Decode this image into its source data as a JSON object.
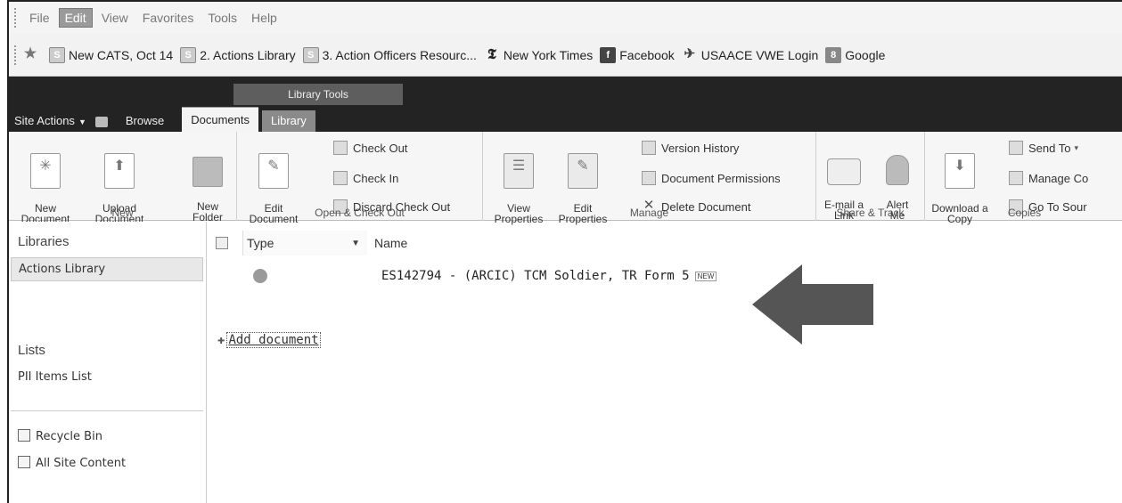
{
  "menu": {
    "items": [
      "File",
      "Edit",
      "View",
      "Favorites",
      "Tools",
      "Help"
    ],
    "active": "Edit"
  },
  "favorites": [
    {
      "label": "New CATS, Oct 14",
      "icon": "sharepoint-icon"
    },
    {
      "label": "2. Actions Library",
      "icon": "sharepoint-icon"
    },
    {
      "label": "3. Action Officers Resourc...",
      "icon": "sharepoint-icon"
    },
    {
      "label": "New York Times",
      "icon": "nyt-icon"
    },
    {
      "label": "Facebook",
      "icon": "facebook-icon"
    },
    {
      "label": "USAACE VWE Login",
      "icon": "plane-icon"
    },
    {
      "label": "Google",
      "icon": "google-icon"
    }
  ],
  "header": {
    "contextual_group": "Library Tools",
    "site_actions": "Site Actions",
    "browse": "Browse",
    "documents_tab": "Documents",
    "library_tab": "Library"
  },
  "ribbon": {
    "new_group": {
      "label": "New",
      "new_document": "New\nDocument",
      "upload_document": "Upload\nDocument",
      "new_folder": "New\nFolder"
    },
    "open_group": {
      "label": "Open & Check Out",
      "edit_document": "Edit\nDocument",
      "check_out": "Check Out",
      "check_in": "Check In",
      "discard_check_out": "Discard Check Out"
    },
    "manage_group": {
      "label": "Manage",
      "view_properties": "View\nProperties",
      "edit_properties": "Edit\nProperties",
      "version_history": "Version History",
      "document_permissions": "Document Permissions",
      "delete_document": "Delete Document"
    },
    "share_group": {
      "label": "Share & Track",
      "email_link": "E-mail a\nLink",
      "alert_me": "Alert\nMe"
    },
    "copies_group": {
      "label": "Copies",
      "download_copy": "Download a\nCopy",
      "send_to": "Send To",
      "manage_copies": "Manage Co",
      "go_to_source": "Go To Sour"
    }
  },
  "leftnav": {
    "libraries_heading": "Libraries",
    "actions_library": "Actions Library",
    "lists_heading": "Lists",
    "pii_items_list": "PII Items List",
    "recycle_bin": "Recycle Bin",
    "all_site_content": "All Site Content"
  },
  "list": {
    "columns": {
      "type": "Type",
      "name": "Name"
    },
    "rows": [
      {
        "name": "ES142794 - (ARCIC) TCM Soldier, TR Form 5",
        "badge": "NEW"
      }
    ],
    "add_document": "Add document"
  }
}
